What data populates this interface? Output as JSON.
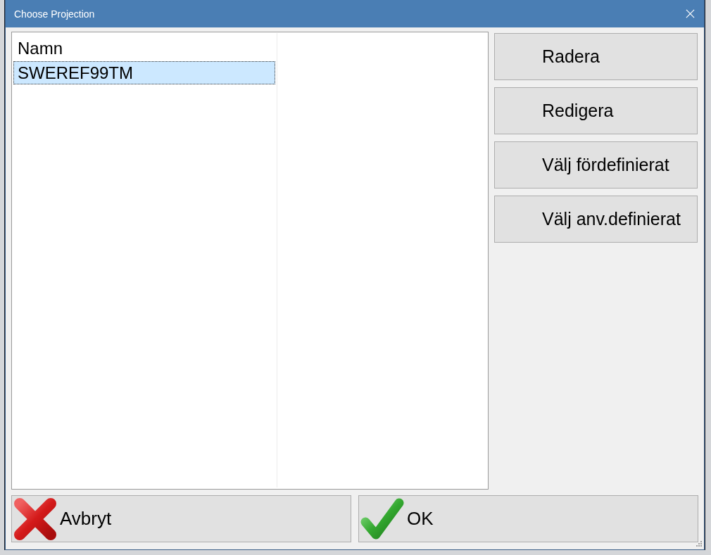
{
  "window": {
    "title": "Choose Projection"
  },
  "list": {
    "columns": [
      "Namn"
    ],
    "rows": [
      {
        "cells": [
          "SWEREF99TM"
        ],
        "selected": true
      }
    ]
  },
  "side_buttons": [
    "Radera",
    "Redigera",
    "Välj fördefinierat",
    "Välj anv.definierat"
  ],
  "footer_buttons": [
    {
      "kind": "cancel",
      "label": "Avbryt"
    },
    {
      "kind": "ok",
      "label": "OK"
    }
  ]
}
